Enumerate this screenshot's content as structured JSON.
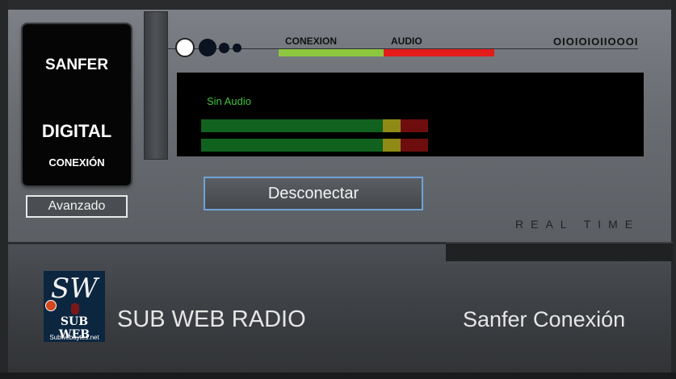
{
  "logo": {
    "line1": "SANFER",
    "line2": "DIGITAL",
    "line3": "CONEXIÓN"
  },
  "buttons": {
    "advanced": "Avanzado",
    "disconnect": "Desconectar"
  },
  "indicators": {
    "connection_label": "CONEXION",
    "audio_label": "AUDIO",
    "binary_text": "OIOIOIOIIOOOI",
    "connection_color": "#8dc63f",
    "audio_color": "#e41b1b"
  },
  "display": {
    "status": "Sin Audio",
    "meters": [
      {
        "name": "left",
        "level": 1.0
      },
      {
        "name": "right",
        "level": 1.0
      }
    ]
  },
  "realtime_label": "REAL TIME",
  "footer": {
    "brand": "SUB WEB RADIO",
    "station": "Sanfer Conexión",
    "logo": {
      "letters": "SW",
      "name": "SUB WEB",
      "site": "Subwebaytes.net"
    }
  }
}
